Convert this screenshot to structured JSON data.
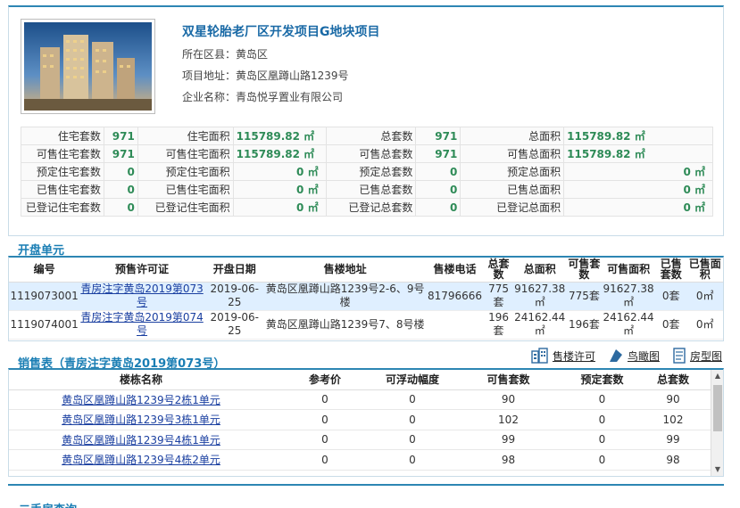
{
  "project": {
    "title": "双星轮胎老厂区开发项目G地块项目",
    "district_label": "所在区县：",
    "district": "黄岛区",
    "address_label": "项目地址：",
    "address": "黄岛区凰蹲山路1239号",
    "company_label": "企业名称：",
    "company": "青岛悦孚置业有限公司"
  },
  "stats": {
    "rows": [
      [
        "住宅套数",
        "971",
        "住宅面积",
        "115789.82 ㎡",
        "总套数",
        "971",
        "总面积",
        "115789.82 ㎡"
      ],
      [
        "可售住宅套数",
        "971",
        "可售住宅面积",
        "115789.82 ㎡",
        "可售总套数",
        "971",
        "可售总面积",
        "115789.82 ㎡"
      ],
      [
        "预定住宅套数",
        "0",
        "预定住宅面积",
        "0 ㎡",
        "预定总套数",
        "0",
        "预定总面积",
        "0 ㎡"
      ],
      [
        "已售住宅套数",
        "0",
        "已售住宅面积",
        "0 ㎡",
        "已售总套数",
        "0",
        "已售总面积",
        "0 ㎡"
      ],
      [
        "已登记住宅套数",
        "0",
        "已登记住宅面积",
        "0 ㎡",
        "已登记总套数",
        "0",
        "已登记总面积",
        "0 ㎡"
      ]
    ]
  },
  "opening": {
    "section_title": "开盘单元",
    "headers": [
      "编号",
      "预售许可证",
      "开盘日期",
      "售楼地址",
      "售楼电话",
      "总套数",
      "总面积",
      "可售套数",
      "可售面积",
      "已售套数",
      "已售面积"
    ],
    "rows": [
      {
        "id": "1119073001",
        "permit": "青房注字黄岛2019第073号",
        "date": "2019-06-25",
        "address": "黄岛区凰蹲山路1239号2-6、9号楼",
        "phone": "81796666",
        "total_units": "775套",
        "total_area": "91627.38㎡",
        "avail_units": "775套",
        "avail_area": "91627.38㎡",
        "sold_units": "0套",
        "sold_area": "0㎡"
      },
      {
        "id": "1119074001",
        "permit": "青房注字黄岛2019第074号",
        "date": "2019-06-25",
        "address": "黄岛区凰蹲山路1239号7、8号楼",
        "phone": "",
        "total_units": "196套",
        "total_area": "24162.44㎡",
        "avail_units": "196套",
        "avail_area": "24162.44㎡",
        "sold_units": "0套",
        "sold_area": "0㎡"
      }
    ]
  },
  "sales": {
    "section_title": "销售表（青房注字黄岛2019第073号）",
    "tools": {
      "permit": "售楼许可",
      "aerial": "鸟瞰图",
      "floorplan": "房型图"
    },
    "headers": [
      "楼栋名称",
      "参考价",
      "可浮动幅度",
      "可售套数",
      "预定套数",
      "总套数"
    ],
    "rows": [
      [
        "黄岛区凰蹲山路1239号2栋1单元",
        "0",
        "0",
        "90",
        "0",
        "90"
      ],
      [
        "黄岛区凰蹲山路1239号3栋1单元",
        "0",
        "0",
        "102",
        "0",
        "102"
      ],
      [
        "黄岛区凰蹲山路1239号4栋1单元",
        "0",
        "0",
        "99",
        "0",
        "99"
      ],
      [
        "黄岛区凰蹲山路1239号4栋2单元",
        "0",
        "0",
        "98",
        "0",
        "98"
      ]
    ]
  },
  "secondhand": {
    "section_title": "二手房查询"
  },
  "colors": {
    "accent": "#2d86b3",
    "value_green": "#2e8b57",
    "link_blue": "#1a3fa0",
    "selected_row": "#dfefff"
  }
}
